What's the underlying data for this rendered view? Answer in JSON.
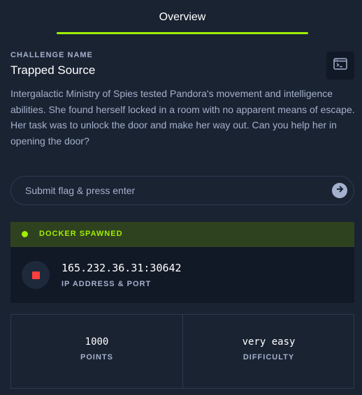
{
  "tabs": [
    {
      "label": "Overview",
      "active": true
    }
  ],
  "challenge": {
    "eyebrow": "CHALLENGE NAME",
    "name": "Trapped Source",
    "description": "Intergalactic Ministry of Spies tested Pandora's movement and intelligence abilities. She found herself locked in a room with no apparent means of escape. Her task was to unlock the door and make her way out. Can you help her in opening the door?",
    "icon": "terminal-icon"
  },
  "flag": {
    "placeholder": "Submit flag & press enter",
    "value": "",
    "submit_icon": "arrow-right-icon"
  },
  "docker": {
    "status": "DOCKER SPAWNED",
    "ip_port": "165.232.36.31:30642",
    "ip_label": "IP ADDRESS & PORT",
    "stop_icon": "stop-icon"
  },
  "stats": {
    "points_value": "1000",
    "points_label": "POINTS",
    "difficulty_value": "very easy",
    "difficulty_label": "DIFFICULTY"
  },
  "colors": {
    "background": "#1a2332",
    "panel": "#111927",
    "accent": "#9fef00",
    "docker_bar": "#2f4220",
    "muted_text": "#a4b1cd",
    "stop": "#ff3e3e",
    "border": "#2c3a4f"
  }
}
